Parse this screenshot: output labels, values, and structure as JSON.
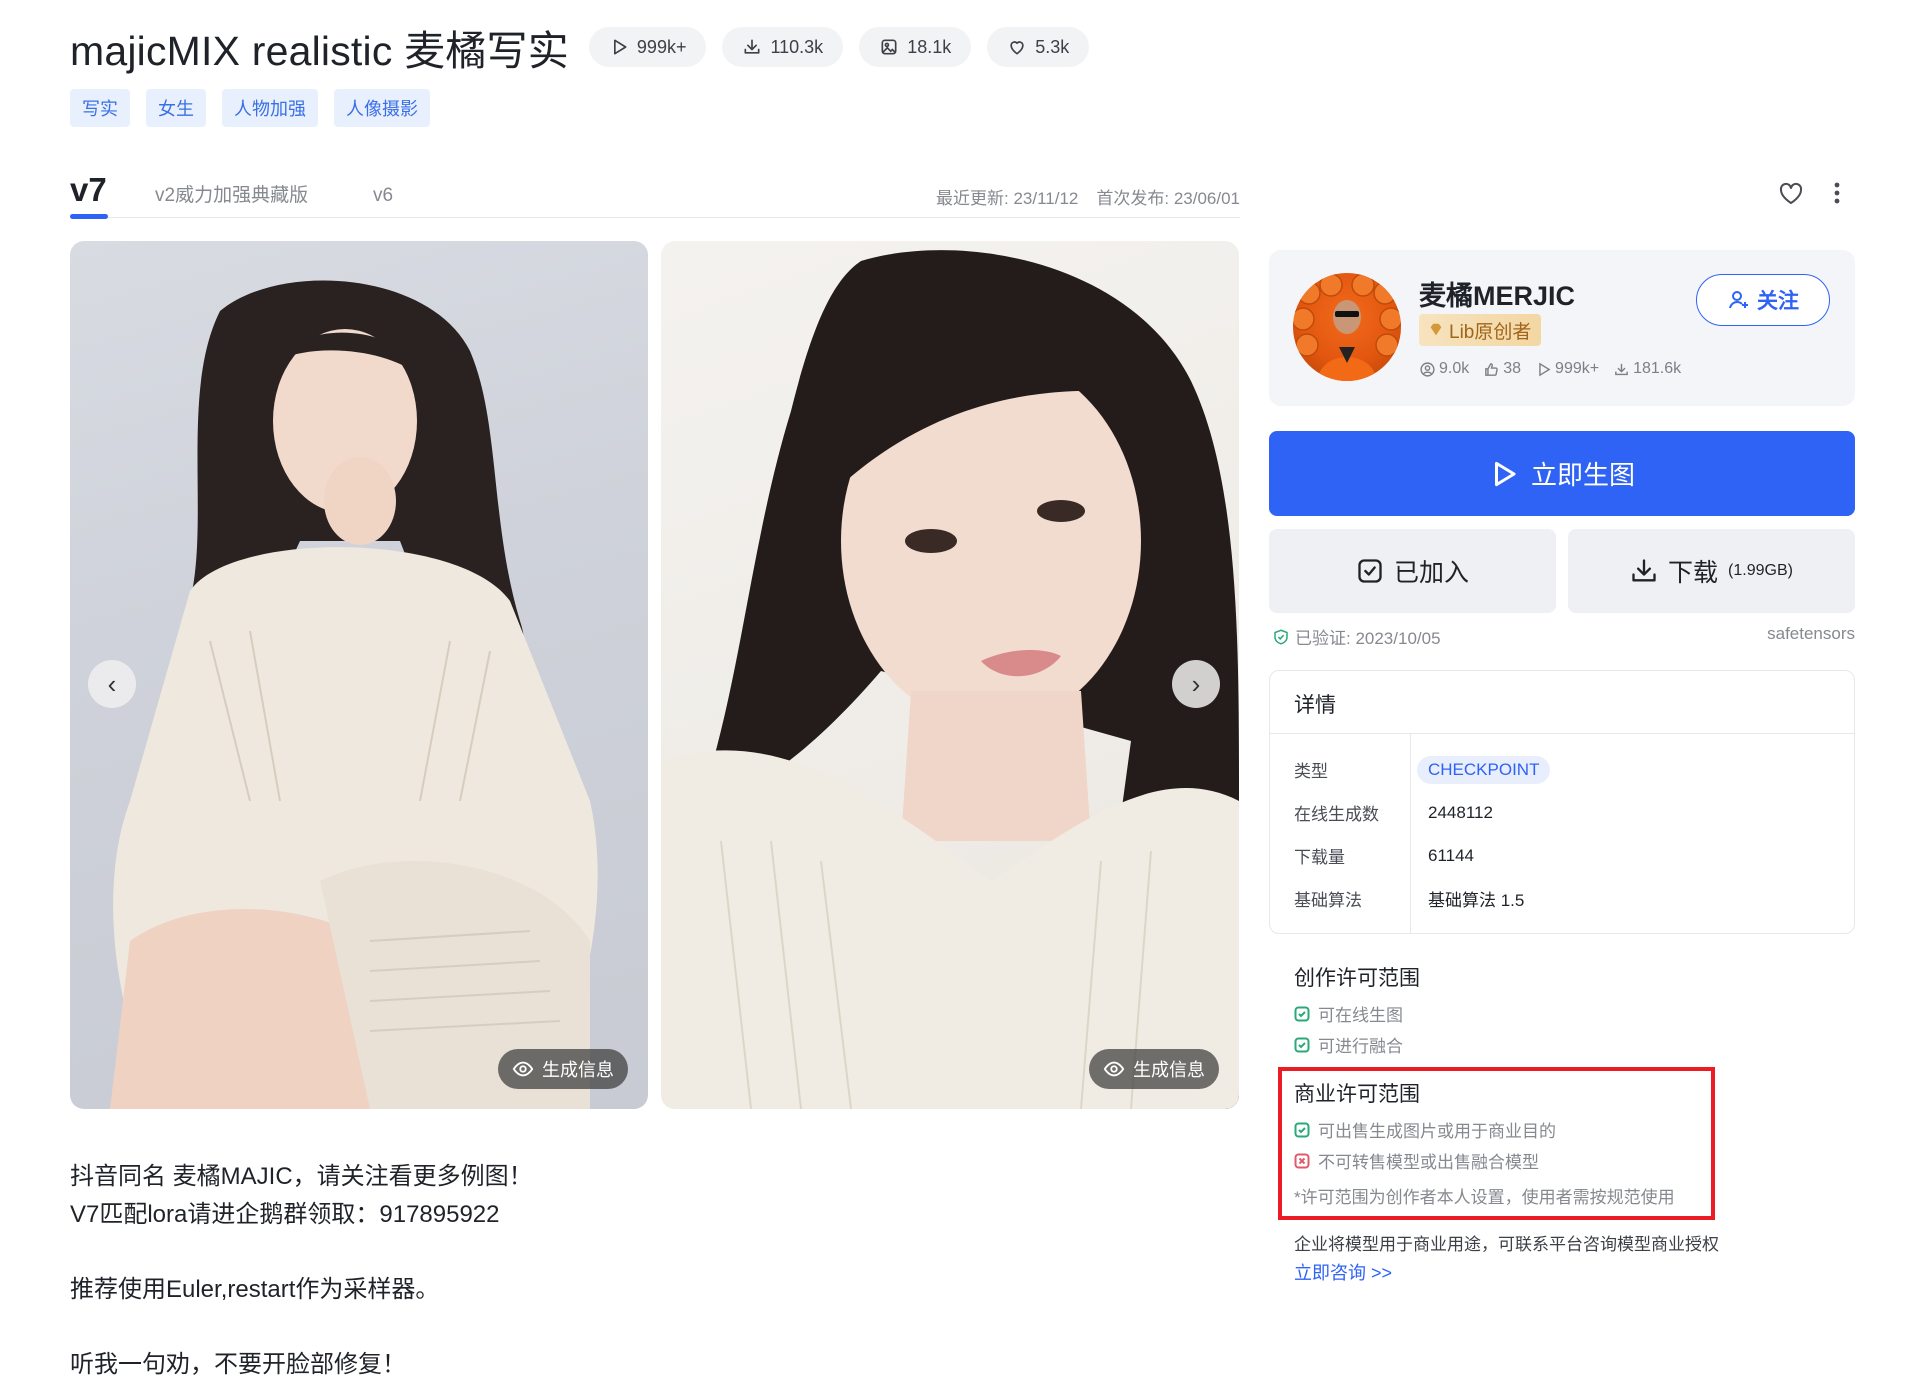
{
  "header": {
    "title": "majicMIX realistic 麦橘写实",
    "stats": [
      {
        "icon": "play-icon",
        "value": "999k+"
      },
      {
        "icon": "download-icon",
        "value": "110.3k"
      },
      {
        "icon": "image-icon",
        "value": "18.1k"
      },
      {
        "icon": "heart-icon",
        "value": "5.3k"
      }
    ],
    "tags": [
      "写实",
      "女生",
      "人物加强",
      "人像摄影"
    ]
  },
  "versions": {
    "tabs": [
      "v7",
      "v2威力加强典藏版",
      "v6"
    ],
    "active": "v7",
    "updated": "最近更新: 23/11/12",
    "published": "首次发布: 23/06/01"
  },
  "gallery": {
    "gen_info_label": "生成信息",
    "prev": "‹",
    "next": "›"
  },
  "description": {
    "lines": [
      "抖音同名 麦橘MAJIC，请关注看更多例图！",
      "V7匹配lora请进企鹅群领取：917895922",
      "推荐使用Euler,restart作为采样器。",
      "听我一句劝，不要开脸部修复！"
    ]
  },
  "author": {
    "name": "麦橘MERJIC",
    "badge": "Lib原创者",
    "stats": {
      "followers": "9.0k",
      "likes": "38",
      "runs": "999k+",
      "downloads": "181.6k"
    },
    "follow_label": "关注"
  },
  "actions": {
    "generate_label": "立即生图",
    "added_label": "已加入",
    "download_label": "下载",
    "download_size": "(1.99GB)"
  },
  "verification": {
    "verified": "已验证: 2023/10/05",
    "format": "safetensors"
  },
  "details": {
    "title": "详情",
    "rows": [
      {
        "key": "类型",
        "value": "CHECKPOINT"
      },
      {
        "key": "在线生成数",
        "value": "2448112"
      },
      {
        "key": "下载量",
        "value": "61144"
      },
      {
        "key": "基础算法",
        "value": "基础算法 1.5"
      }
    ]
  },
  "license": {
    "creative": {
      "title": "创作许可范围",
      "items": [
        {
          "text": "可在线生图",
          "allowed": true
        },
        {
          "text": "可进行融合",
          "allowed": true
        }
      ]
    },
    "commercial": {
      "title": "商业许可范围",
      "items": [
        {
          "text": "可出售生成图片或用于商业目的",
          "allowed": true
        },
        {
          "text": "不可转售模型或出售融合模型",
          "allowed": false
        }
      ],
      "note": "*许可范围为创作者本人设置，使用者需按规范使用"
    },
    "enterprise_text": "企业将模型用于商业用途，可联系平台咨询模型商业授权",
    "consult_link": "立即咨询 >>"
  },
  "colors": {
    "accent": "#2f63f6",
    "tag_bg": "#e8f0fd",
    "highlight": "#ec1c24",
    "allowed": "#2aa876",
    "denied": "#e25a6a"
  }
}
